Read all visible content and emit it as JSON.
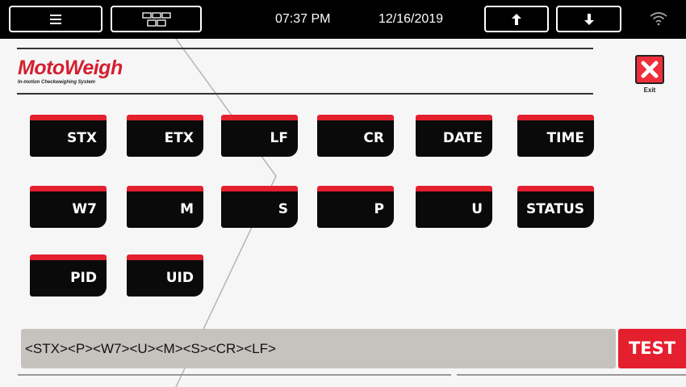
{
  "topbar": {
    "time": "07:37 PM",
    "date": "12/16/2019"
  },
  "logo": {
    "name": "MotoWeigh",
    "tagline": "In-motion Checkweighing System"
  },
  "exit": {
    "label": "Exit"
  },
  "fields": [
    "STX",
    "ETX",
    "LF",
    "CR",
    "DATE",
    "TIME",
    "W7",
    "M",
    "S",
    "P",
    "U",
    "STATUS",
    "PID",
    "UID"
  ],
  "format_string": "<STX><P><W7><U><M><S><CR><LF>",
  "test": {
    "label": "TEST"
  },
  "colors": {
    "accent": "#e41f2e",
    "bar": "#000000",
    "display": "#c6c3bf"
  }
}
